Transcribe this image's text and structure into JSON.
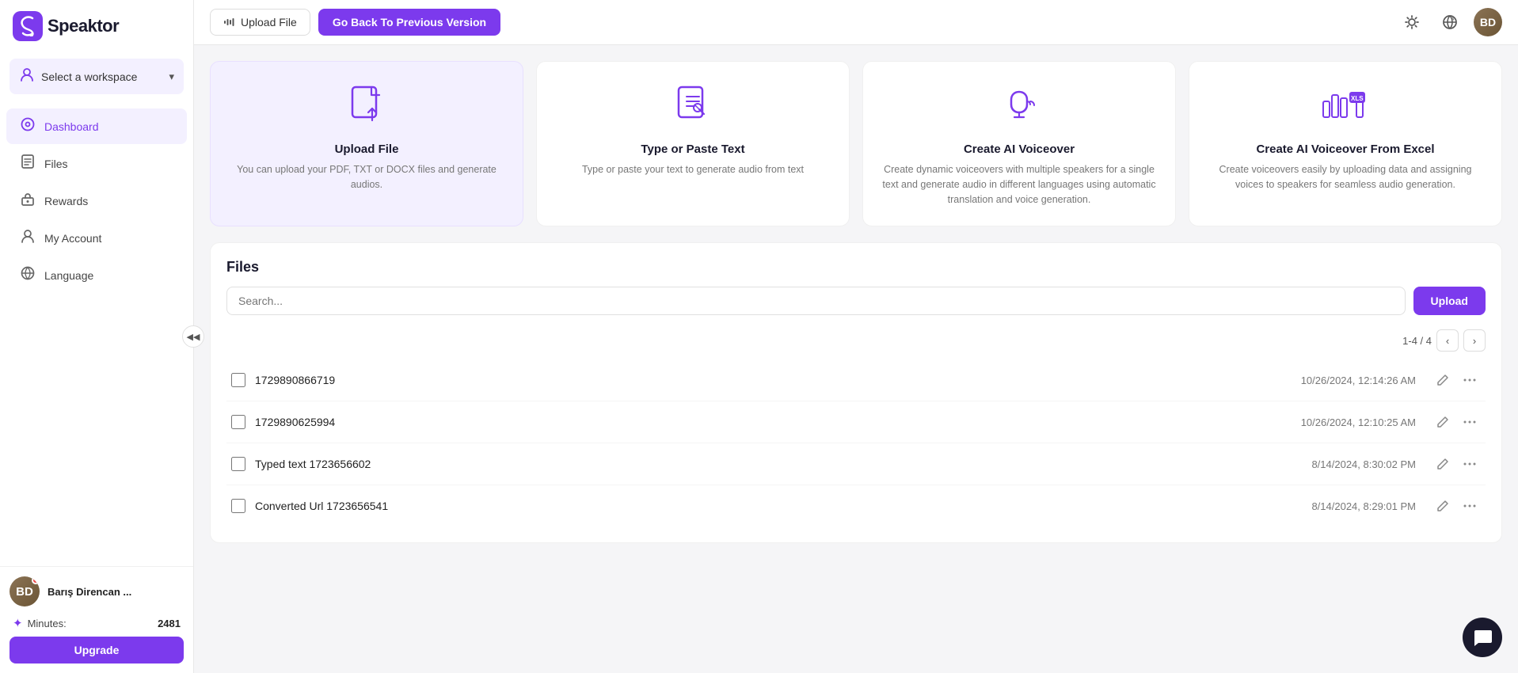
{
  "app": {
    "name": "Speaktor",
    "logo_letter": "S"
  },
  "sidebar": {
    "workspace": {
      "label": "Select a workspace",
      "icon": "person"
    },
    "nav_items": [
      {
        "id": "dashboard",
        "label": "Dashboard",
        "active": true
      },
      {
        "id": "files",
        "label": "Files",
        "active": false
      },
      {
        "id": "rewards",
        "label": "Rewards",
        "active": false
      },
      {
        "id": "my-account",
        "label": "My Account",
        "active": false
      },
      {
        "id": "language",
        "label": "Language",
        "active": false
      }
    ],
    "user": {
      "name": "Barış Direncan ...",
      "initials": "BD"
    },
    "minutes_label": "Minutes:",
    "minutes_value": "2481",
    "upgrade_label": "Upgrade"
  },
  "topbar": {
    "upload_file_label": "Upload File",
    "go_back_label": "Go Back To Previous Version",
    "search_placeholder": "Search..."
  },
  "cards": [
    {
      "id": "upload-file",
      "title": "Upload File",
      "description": "You can upload your PDF, TXT or DOCX files and generate audios.",
      "highlighted": true
    },
    {
      "id": "type-paste",
      "title": "Type or Paste Text",
      "description": "Type or paste your text to generate audio from text",
      "highlighted": false
    },
    {
      "id": "ai-voiceover",
      "title": "Create AI Voiceover",
      "description": "Create dynamic voiceovers with multiple speakers for a single text and generate audio in different languages using automatic translation and voice generation.",
      "highlighted": false
    },
    {
      "id": "excel-voiceover",
      "title": "Create AI Voiceover From Excel",
      "description": "Create voiceovers easily by uploading data and assigning voices to speakers for seamless audio generation.",
      "highlighted": false
    }
  ],
  "files_section": {
    "title": "Files",
    "upload_label": "Upload",
    "search_placeholder": "Search...",
    "pagination": "1-4 / 4",
    "files": [
      {
        "id": "file-1",
        "name": "1729890866719",
        "date": "10/26/2024, 12:14:26 AM"
      },
      {
        "id": "file-2",
        "name": "1729890625994",
        "date": "10/26/2024, 12:10:25 AM"
      },
      {
        "id": "file-3",
        "name": "Typed text 1723656602",
        "date": "8/14/2024, 8:30:02 PM"
      },
      {
        "id": "file-4",
        "name": "Converted Url 1723656541",
        "date": "8/14/2024, 8:29:01 PM"
      }
    ]
  },
  "colors": {
    "brand": "#7c3aed",
    "brand_light": "#f3f0ff"
  }
}
